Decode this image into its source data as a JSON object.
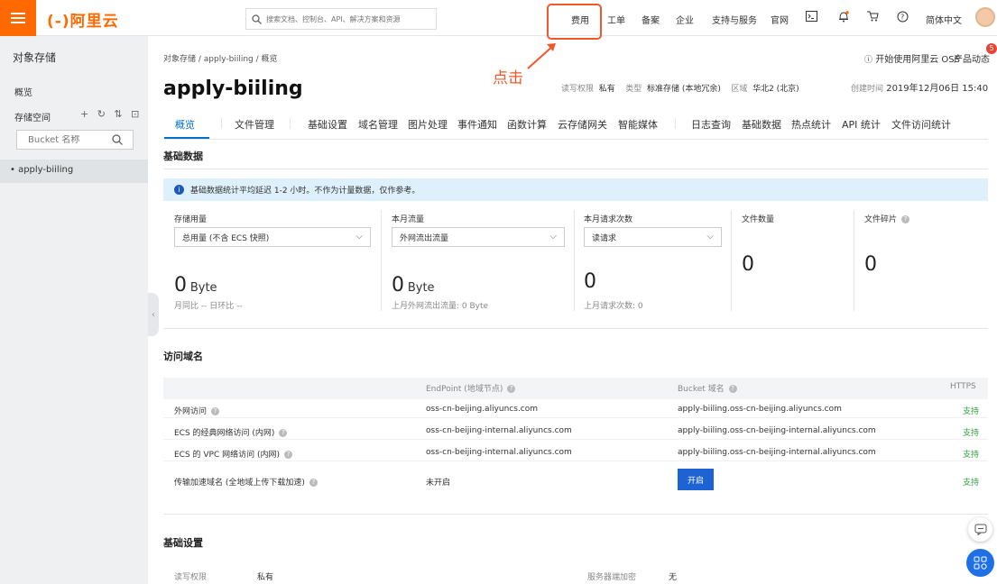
{
  "topbar": {
    "logo": "(-)阿里云",
    "search_placeholder": "搜索文档、控制台、API、解决方案和资源",
    "nav": [
      "费用",
      "工单",
      "备案",
      "企业",
      "支持与服务",
      "官网"
    ],
    "lang": "简体中文"
  },
  "annotation": {
    "text": "点击",
    "color": "#f2572a"
  },
  "sidebar": {
    "title": "对象存储",
    "overview": "概览",
    "storage_space": "存储空间",
    "ops": "+ ↻ ⇅ ⊡",
    "bucket_search_placeholder": "Bucket 名称",
    "buckets": [
      "apply-biiling"
    ]
  },
  "breadcrumb": "对象存储 / apply-biiling / 概览",
  "help": {
    "start": "开始使用阿里云 OSS",
    "news": "产品动态",
    "badge": "5"
  },
  "bucket": {
    "name": "apply-biiling",
    "meta": [
      {
        "label": "读写权限",
        "value": "私有"
      },
      {
        "label": "类型",
        "value": "标准存储 (本地冗余)"
      },
      {
        "label": "区域",
        "value": "华北2 (北京)"
      },
      {
        "label": "创建时间",
        "value": "2019年12月06日 15:40"
      }
    ]
  },
  "tabs": [
    "概览",
    "文件管理",
    "基础设置",
    "域名管理",
    "图片处理",
    "事件通知",
    "函数计算",
    "云存储网关",
    "智能媒体",
    "日志查询",
    "基础数据",
    "热点统计",
    "API 统计",
    "文件访问统计"
  ],
  "basic_data": {
    "title": "基础数据",
    "notice": "基础数据统计平均延迟 1-2 小时。不作为计量数据，仅作参考。",
    "metrics": [
      {
        "label": "存储用量",
        "select": "总用量 (不含 ECS 快照)",
        "value": "0",
        "unit": "Byte",
        "sub": "月同比 -- 日环比 --"
      },
      {
        "label": "本月流量",
        "select": "外网流出流量",
        "value": "0",
        "unit": "Byte",
        "sub": "上月外网流出流量: 0 Byte"
      },
      {
        "label": "本月请求次数",
        "select": "读请求",
        "value": "0",
        "unit": "",
        "sub": "上月请求次数:  0"
      },
      {
        "label": "文件数量",
        "value": "0"
      },
      {
        "label": "文件碎片",
        "value": "0"
      }
    ]
  },
  "domains": {
    "title": "访问域名",
    "headers": [
      "EndPoint (地域节点)",
      "Bucket 域名",
      "HTTPS"
    ],
    "rows": [
      {
        "name": "外网访问",
        "endpoint": "oss-cn-beijing.aliyuncs.com",
        "domain": "apply-biiling.oss-cn-beijing.aliyuncs.com",
        "https": "支持"
      },
      {
        "name": "ECS 的经典网络访问 (内网)",
        "endpoint": "oss-cn-beijing-internal.aliyuncs.com",
        "domain": "apply-biiling.oss-cn-beijing-internal.aliyuncs.com",
        "https": "支持"
      },
      {
        "name": "ECS 的 VPC 网络访问 (内网)",
        "endpoint": "oss-cn-beijing-internal.aliyuncs.com",
        "domain": "apply-biiling.oss-cn-beijing-internal.aliyuncs.com",
        "https": "支持"
      },
      {
        "name": "传输加速域名 (全地域上传下载加速)",
        "endpoint": "未开启",
        "domain": "",
        "https": "支持",
        "button": "开启"
      }
    ]
  },
  "settings": {
    "title": "基础设置",
    "rw_label": "读写权限",
    "rw_value": "私有",
    "enc_label": "服务器端加密",
    "enc_value": "无"
  }
}
